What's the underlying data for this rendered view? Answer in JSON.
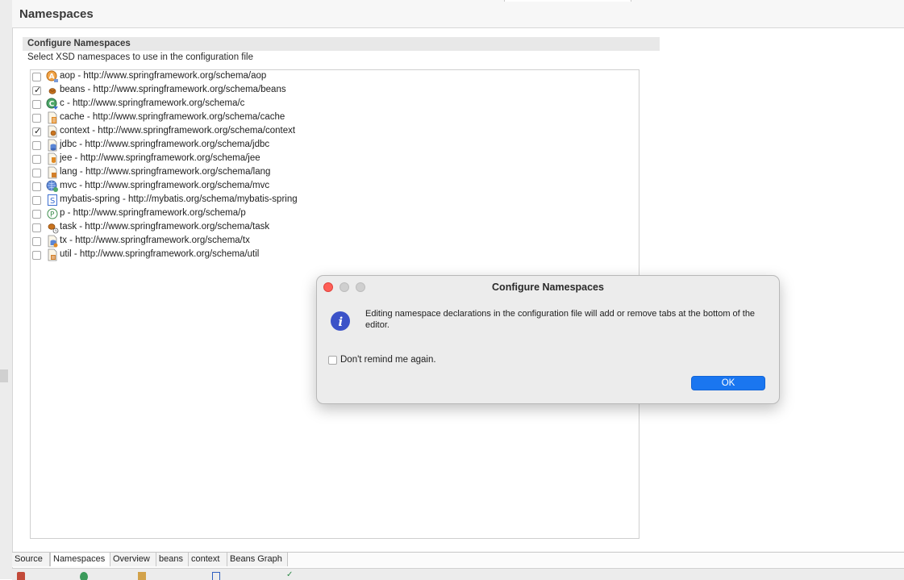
{
  "header": {
    "title": "Namespaces"
  },
  "section": {
    "title": "Configure Namespaces",
    "description": "Select XSD namespaces to use in the configuration file"
  },
  "namespaces": [
    {
      "label": "aop - http://www.springframework.org/schema/aop",
      "checked": false,
      "icon": "aop-icon"
    },
    {
      "label": "beans - http://www.springframework.org/schema/beans",
      "checked": true,
      "icon": "bean-icon"
    },
    {
      "label": "c - http://www.springframework.org/schema/c",
      "checked": false,
      "icon": "c-namespace-icon"
    },
    {
      "label": "cache - http://www.springframework.org/schema/cache",
      "checked": false,
      "icon": "cache-icon"
    },
    {
      "label": "context - http://www.springframework.org/schema/context",
      "checked": true,
      "icon": "context-icon"
    },
    {
      "label": "jdbc - http://www.springframework.org/schema/jdbc",
      "checked": false,
      "icon": "jdbc-icon"
    },
    {
      "label": "jee - http://www.springframework.org/schema/jee",
      "checked": false,
      "icon": "jee-icon"
    },
    {
      "label": "lang - http://www.springframework.org/schema/lang",
      "checked": false,
      "icon": "lang-icon"
    },
    {
      "label": "mvc - http://www.springframework.org/schema/mvc",
      "checked": false,
      "icon": "mvc-icon"
    },
    {
      "label": "mybatis-spring - http://mybatis.org/schema/mybatis-spring",
      "checked": false,
      "icon": "mybatis-icon"
    },
    {
      "label": "p - http://www.springframework.org/schema/p",
      "checked": false,
      "icon": "p-namespace-icon"
    },
    {
      "label": "task - http://www.springframework.org/schema/task",
      "checked": false,
      "icon": "task-icon"
    },
    {
      "label": "tx - http://www.springframework.org/schema/tx",
      "checked": false,
      "icon": "tx-icon"
    },
    {
      "label": "util - http://www.springframework.org/schema/util",
      "checked": false,
      "icon": "util-icon"
    }
  ],
  "editor_tabs": [
    {
      "label": "Source",
      "active": false
    },
    {
      "label": "Namespaces",
      "active": true
    },
    {
      "label": "Overview",
      "active": false
    },
    {
      "label": "beans",
      "active": false
    },
    {
      "label": "context",
      "active": false
    },
    {
      "label": "Beans Graph",
      "active": false
    }
  ],
  "dialog": {
    "title": "Configure Namespaces",
    "message": "Editing namespace declarations in the configuration file will add or remove tabs at the bottom of the editor.",
    "checkbox_label": "Don't remind me again.",
    "checkbox_checked": false,
    "ok_label": "OK",
    "icon": "info-icon"
  },
  "colors": {
    "accent": "#1a76f0",
    "close_light": "#ff5f57",
    "info_icon": "#3b52c8"
  }
}
